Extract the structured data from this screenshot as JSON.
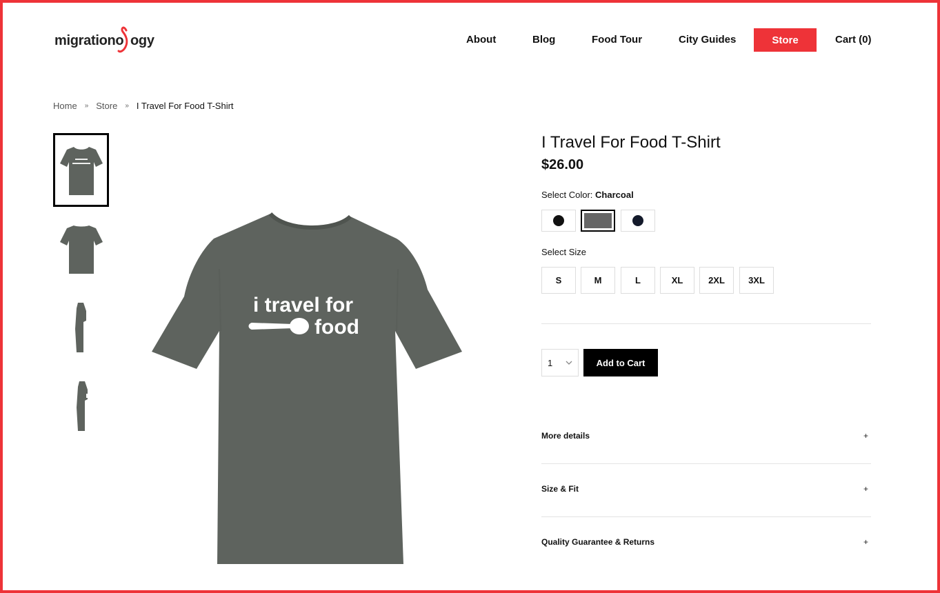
{
  "header": {
    "logo_text": "migrationology",
    "nav": [
      {
        "label": "About"
      },
      {
        "label": "Blog"
      },
      {
        "label": "Food Tour"
      },
      {
        "label": "City Guides"
      },
      {
        "label": "Store"
      },
      {
        "label": "Cart (0)"
      }
    ],
    "brand_color": "#ee3338"
  },
  "breadcrumb": {
    "items": [
      "Home",
      "Store",
      "I Travel For Food T-Shirt"
    ],
    "separator": "»"
  },
  "product": {
    "title": "I Travel For Food T-Shirt",
    "price": "$26.00",
    "shirt_text_line1": "i travel for",
    "shirt_text_line2": "food",
    "shirt_color": "#5e635e",
    "color_label": "Select Color:",
    "selected_color": "Charcoal",
    "colors": [
      {
        "name": "black-swatch",
        "hex": "#111111"
      },
      {
        "name": "charcoal-swatch",
        "hex": "#666666"
      },
      {
        "name": "navy-swatch",
        "hex": "#141a2b"
      }
    ],
    "size_label": "Select Size",
    "sizes": [
      "S",
      "M",
      "L",
      "XL",
      "2XL",
      "3XL"
    ],
    "quantity": "1",
    "add_to_cart": "Add to Cart",
    "accordions": [
      {
        "title": "More details",
        "icon": "+"
      },
      {
        "title": "Size & Fit",
        "icon": "+"
      },
      {
        "title": "Quality Guarantee & Returns",
        "icon": "+"
      }
    ]
  }
}
